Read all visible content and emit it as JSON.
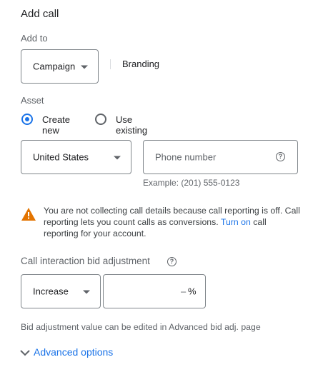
{
  "title": "Add call",
  "add_to": {
    "label": "Add to",
    "dropdown_value": "Campaign",
    "selected_name": "Branding"
  },
  "asset": {
    "label": "Asset",
    "option_create": "Create new",
    "option_existing": "Use existing",
    "selected": "create"
  },
  "phone": {
    "country": "United States",
    "placeholder": "Phone number",
    "example": "Example: (201) 555-0123"
  },
  "warning": {
    "text_before": "You are not collecting call details because call reporting is off. Call reporting lets you count calls as conversions.",
    "link": "Turn on",
    "text_after": "call reporting for your account."
  },
  "bid": {
    "label": "Call interaction bid adjustment",
    "direction": "Increase",
    "value": "",
    "dash": "–",
    "unit": "%",
    "note": "Bid adjustment value can be edited in Advanced bid adj. page"
  },
  "advanced": {
    "label": "Advanced options"
  },
  "colors": {
    "accent": "#1a73e8",
    "warning": "#e37400",
    "border": "#80868b"
  }
}
